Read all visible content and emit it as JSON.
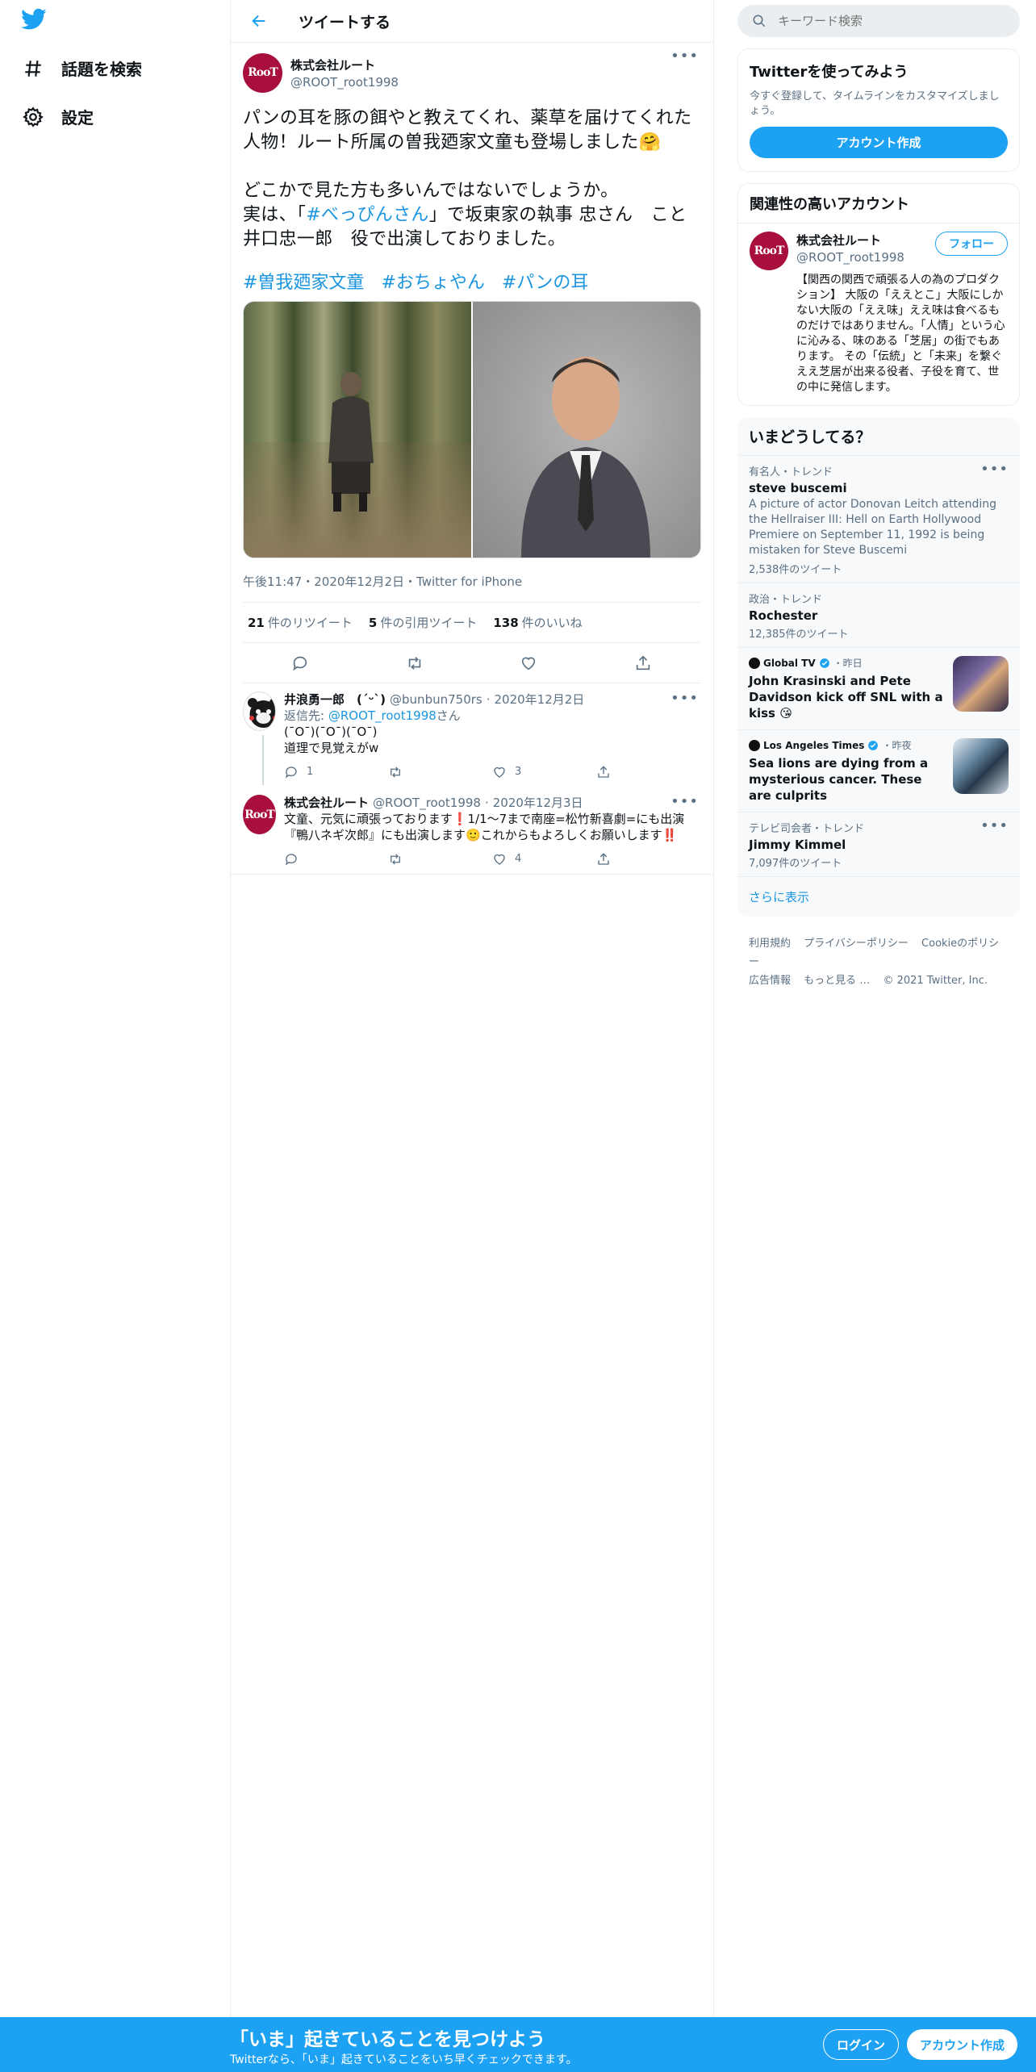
{
  "nav": {
    "explore_label": "話題を検索",
    "settings_label": "設定"
  },
  "header": {
    "title": "ツイートする"
  },
  "tweet": {
    "author_name": "株式会社ルート",
    "author_handle": "@ROOT_root1998",
    "avatar_text": "RooT",
    "text_line1": "パンの耳を豚の餌やと教えてくれ、薬草を届けてくれた人物！ルート所属の曽我廼家文童も登場しました🤗",
    "text_line2": "どこかで見た方も多いんではないでしょうか。",
    "text_line3_pre": "実は、「",
    "text_line3_link": "#べっぴんさん",
    "text_line3_post": "」で坂東家の執事 忠さん　こと　井口忠一郎　役で出演しておりました。",
    "tags": [
      "#曽我廼家文童",
      "#おちょやん",
      "#パンの耳"
    ],
    "meta": "午後11:47・2020年12月2日・Twitter for iPhone",
    "retweets_count": "21",
    "retweets_label": "件のリツイート",
    "quotes_count": "5",
    "quotes_label": "件の引用ツイート",
    "likes_count": "138",
    "likes_label": "件のいいね"
  },
  "replies": [
    {
      "name": "井浪勇一郎　(ˊᵕˋ)",
      "handle": "@bunbun750rs",
      "date": "2020年12月2日",
      "reply_to_label": "返信先:",
      "reply_to": "@ROOT_root1998",
      "reply_to_suffix": "さん",
      "line1": "(¯O¯)(¯O¯)(¯O¯)",
      "line2": "道理で見覚えがw",
      "reply_count": "1",
      "retweet_count": "",
      "like_count": "3"
    },
    {
      "name": "株式会社ルート",
      "handle": "@ROOT_root1998",
      "date": "2020年12月3日",
      "line1": "文童、元気に頑張っております❗️1/1～7まで南座=松竹新喜劇=にも出演",
      "line2": "『鴨八ネギ次郎』にも出演します🙂これからもよろしくお願いします‼️",
      "reply_count": "",
      "retweet_count": "",
      "like_count": "4"
    }
  ],
  "sidebar": {
    "search_placeholder": "キーワード検索",
    "signup_title": "Twitterを使ってみよう",
    "signup_sub": "今すぐ登録して、タイムラインをカスタマイズしましょう。",
    "signup_button": "アカウント作成",
    "related_title": "関連性の高いアカウント",
    "related_name": "株式会社ルート",
    "related_handle": "@ROOT_root1998",
    "follow_button": "フォロー",
    "related_bio": "【関西の関西で頑張る人の為のプロダクション】 大阪の「ええとこ」大阪にしかない大阪の「ええ味」ええ味は食べるものだけではありません。「人情」という心に沁みる、味のある「芝居」の街でもあります。 その「伝統」と「未来」を繋ぐええ芝居が出来る役者、子役を育て、世の中に発信します。",
    "trends_title": "いまどうしてる？",
    "trend1": {
      "category": "有名人・トレンド",
      "name": "steve buscemi",
      "desc": "A picture of actor Donovan Leitch attending the Hellraiser III: Hell on Earth Hollywood Premiere on September 11, 1992 is being mistaken for Steve Buscemi",
      "count": "2,538件のツイート"
    },
    "trend2": {
      "category": "政治・トレンド",
      "name": "Rochester",
      "count": "12,385件のツイート"
    },
    "news1": {
      "source": "Global TV",
      "time": "・昨日",
      "title": "John Krasinski and Pete Davidson kick off SNL with a kiss 😘"
    },
    "news2": {
      "source": "Los Angeles Times",
      "time": "・昨夜",
      "title": "Sea lions are dying from a mysterious cancer. These are culprits"
    },
    "trend3": {
      "category": "テレビ司会者・トレンド",
      "name": "Jimmy Kimmel",
      "count": "7,097件のツイート"
    },
    "show_more": "さらに表示",
    "footer_terms": "利用規約",
    "footer_privacy": "プライバシーポリシー",
    "footer_cookie": "Cookieのポリシー",
    "footer_ads": "広告情報",
    "footer_more": "もっと見る …",
    "footer_copy": "© 2021 Twitter, Inc."
  },
  "bottombar": {
    "title": "「いま」起きていることを見つけよう",
    "sub": "Twitterなら、「いま」起きていることをいち早くチェックできます。",
    "login": "ログイン",
    "signup": "アカウント作成"
  },
  "colors": {
    "accent": "#1da1f2",
    "brand_avatar": "#a80f3d"
  }
}
